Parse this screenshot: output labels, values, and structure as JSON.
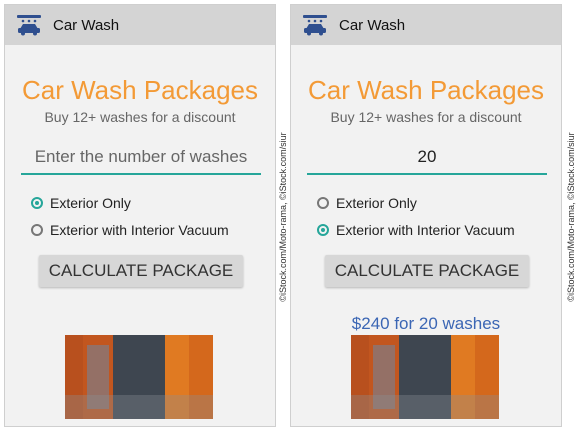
{
  "screens": [
    {
      "app_title": "Car Wash",
      "heading": "Car Wash Packages",
      "subheading": "Buy 12+ washes for a discount",
      "washes_input": {
        "value": "",
        "placeholder": "Enter the number of washes"
      },
      "options": [
        {
          "label": "Exterior Only",
          "selected": true
        },
        {
          "label": "Exterior with Interior Vacuum",
          "selected": false
        }
      ],
      "button_label": "CALCULATE PACKAGE",
      "result": ""
    },
    {
      "app_title": "Car Wash",
      "heading": "Car Wash Packages",
      "subheading": "Buy 12+ washes for a discount",
      "washes_input": {
        "value": "20",
        "placeholder": "Enter the number of washes"
      },
      "options": [
        {
          "label": "Exterior Only",
          "selected": false
        },
        {
          "label": "Exterior with Interior Vacuum",
          "selected": true
        }
      ],
      "button_label": "CALCULATE PACKAGE",
      "result": "$240 for 20 washes"
    }
  ],
  "credit": "©iStock.com/Moto-rama, ©iStock.com/siur",
  "icons": {
    "app": "car-wash-icon",
    "photo": "car-wash-brushes-photo"
  },
  "colors": {
    "accent_orange": "#f39a36",
    "accent_teal": "#26a69a",
    "result_blue": "#3b66b4",
    "appbar_gray": "#d4d4d4"
  }
}
